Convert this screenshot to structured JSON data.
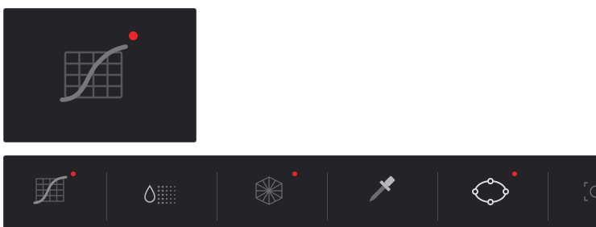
{
  "zoomed_tool": {
    "icon": "curves-icon",
    "active": true
  },
  "toolbar": {
    "tools": [
      {
        "name": "curves",
        "icon": "curves-icon",
        "active": true
      },
      {
        "name": "color-warper",
        "icon": "color-warper-icon",
        "active": false
      },
      {
        "name": "hsl-qualifier-3d",
        "icon": "qualifier-3d-icon",
        "active": true
      },
      {
        "name": "qualifier",
        "icon": "eyedropper-icon",
        "active": false
      },
      {
        "name": "power-window",
        "icon": "window-icon",
        "active": true
      },
      {
        "name": "tracker",
        "icon": "tracker-icon",
        "active": false
      }
    ]
  },
  "colors": {
    "panel_bg": "#242428",
    "icon_gray": "#6b6b70",
    "icon_light": "#b8b8bc",
    "active_dot": "#e8262b"
  }
}
